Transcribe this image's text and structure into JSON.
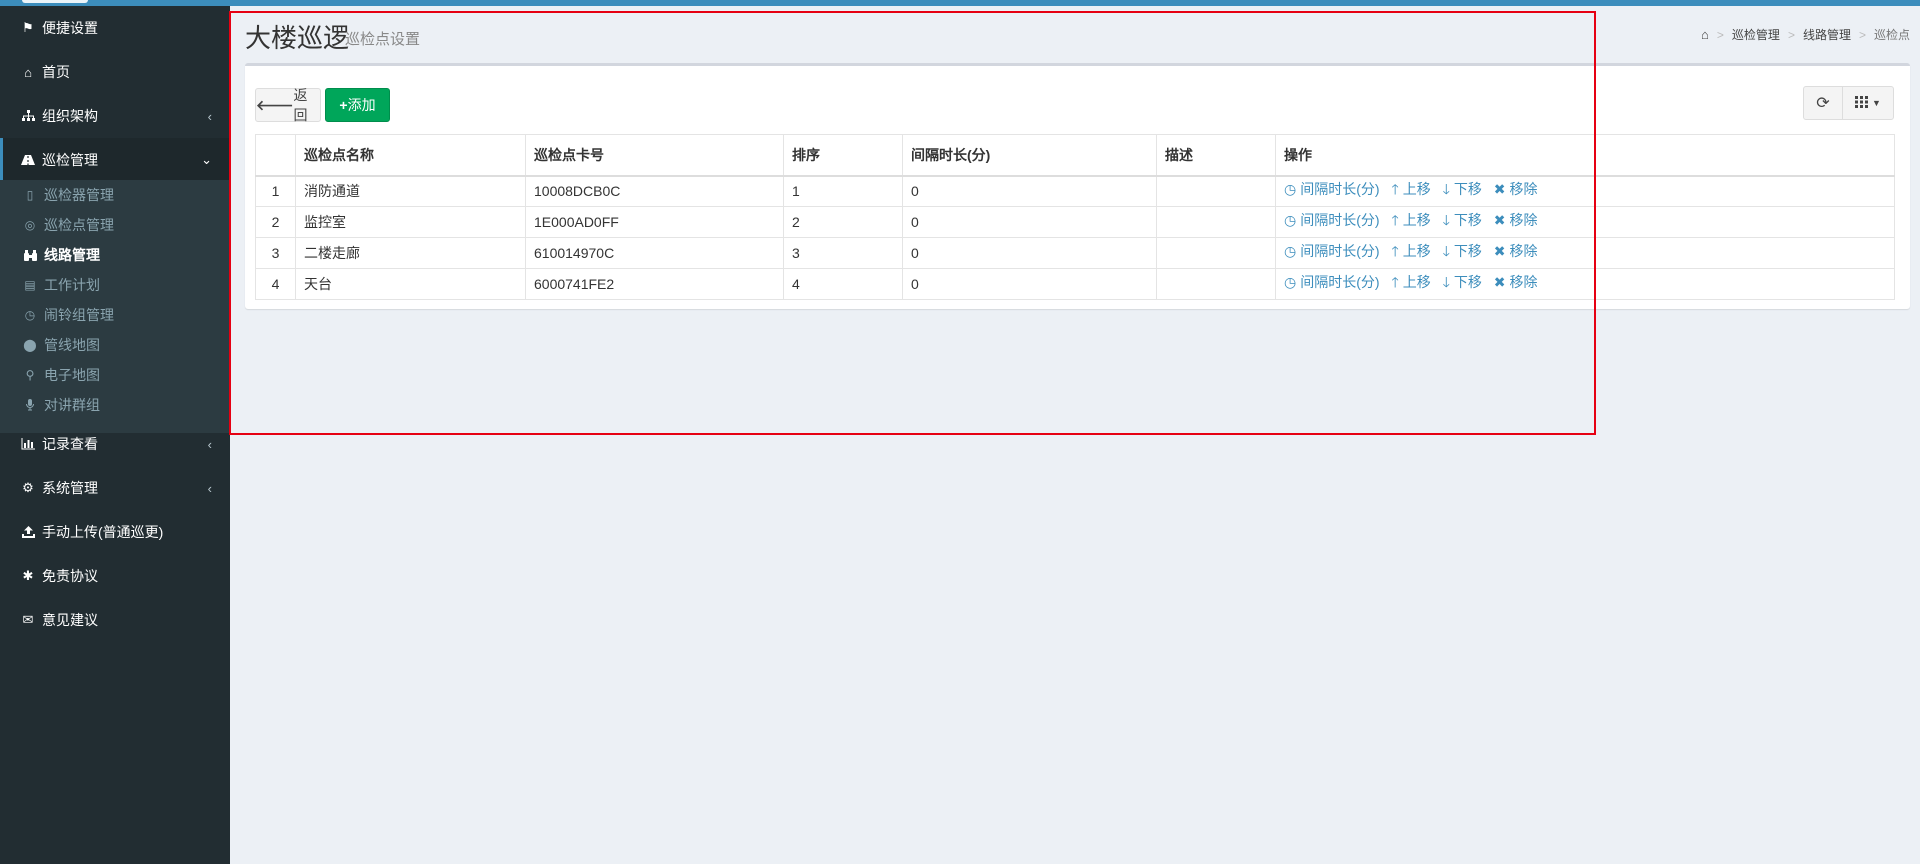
{
  "sidebar": {
    "items": [
      {
        "label": "便捷设置",
        "icon": "flag-icon"
      },
      {
        "label": "首页",
        "icon": "home-icon"
      },
      {
        "label": "组织架构",
        "icon": "sitemap-icon"
      },
      {
        "label": "巡检管理",
        "icon": "road-icon"
      },
      {
        "label": "记录查看",
        "icon": "bar-chart-icon"
      },
      {
        "label": "系统管理",
        "icon": "gear-icon"
      },
      {
        "label": "手动上传(普通巡更)",
        "icon": "upload-icon"
      },
      {
        "label": "免责协议",
        "icon": "asterisk-icon"
      },
      {
        "label": "意见建议",
        "icon": "envelope-icon"
      }
    ],
    "submenu": [
      {
        "label": "巡检器管理",
        "icon": "device-icon"
      },
      {
        "label": "巡检点管理",
        "icon": "pin-icon"
      },
      {
        "label": "线路管理",
        "icon": "route-icon"
      },
      {
        "label": "工作计划",
        "icon": "calendar-icon"
      },
      {
        "label": "闹铃组管理",
        "icon": "clock-icon"
      },
      {
        "label": "管线地图",
        "icon": "map-marker-icon"
      },
      {
        "label": "电子地图",
        "icon": "pushpin-icon"
      },
      {
        "label": "对讲群组",
        "icon": "microphone-icon"
      }
    ]
  },
  "header": {
    "title": "大楼巡逻",
    "subtitle": "巡检点设置",
    "breadcrumb": [
      "巡检管理",
      "线路管理",
      "巡检点"
    ]
  },
  "toolbar": {
    "back_label": "返回",
    "add_label": "添加"
  },
  "table": {
    "columns": [
      "巡检点名称",
      "巡检点卡号",
      "排序",
      "间隔时长(分)",
      "描述",
      "操作"
    ],
    "rows": [
      {
        "index": "1",
        "name": "消防通道",
        "card": "10008DCB0C",
        "order": "1",
        "interval": "0",
        "desc": ""
      },
      {
        "index": "2",
        "name": "监控室",
        "card": "1E000AD0FF",
        "order": "2",
        "interval": "0",
        "desc": ""
      },
      {
        "index": "3",
        "name": "二楼走廊",
        "card": "610014970C",
        "order": "3",
        "interval": "0",
        "desc": ""
      },
      {
        "index": "4",
        "name": "天台",
        "card": "6000741FE2",
        "order": "4",
        "interval": "0",
        "desc": ""
      }
    ],
    "actions": {
      "interval": "间隔时长(分)",
      "up": "上移",
      "down": "下移",
      "remove": "移除"
    }
  },
  "colors": {
    "sidebar_bg": "#222d32",
    "accent": "#3c8dbc",
    "add_button": "#00a65a",
    "highlight": "#e60012"
  }
}
